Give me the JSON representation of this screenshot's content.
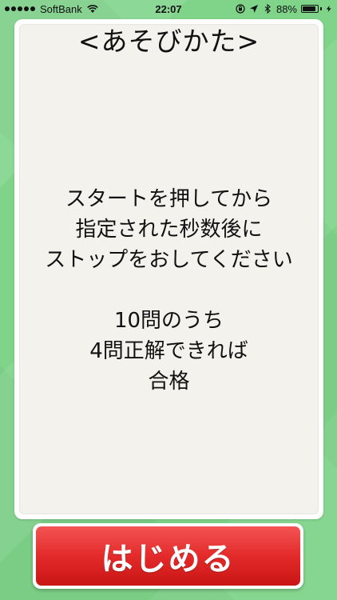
{
  "status_bar": {
    "carrier": "SoftBank",
    "time": "22:07",
    "battery_percent": "88%",
    "battery_level": 0.88,
    "icons": [
      "signal-dots",
      "wifi-icon",
      "orientation-lock-icon",
      "location-icon",
      "bluetooth-icon",
      "battery-icon",
      "charging-icon"
    ]
  },
  "card": {
    "title": "<あそびかた>",
    "lines": [
      "スタートを押してから",
      "指定された秒数後に",
      "ストップをおしてください"
    ],
    "pass_lines": [
      "10問のうち",
      "4問正解できれば",
      "合格"
    ]
  },
  "start_button": {
    "label": "はじめる"
  },
  "colors": {
    "background": "#7fd48a",
    "button_red": "#e42a2a",
    "card_bg": "#f4f2ec"
  }
}
